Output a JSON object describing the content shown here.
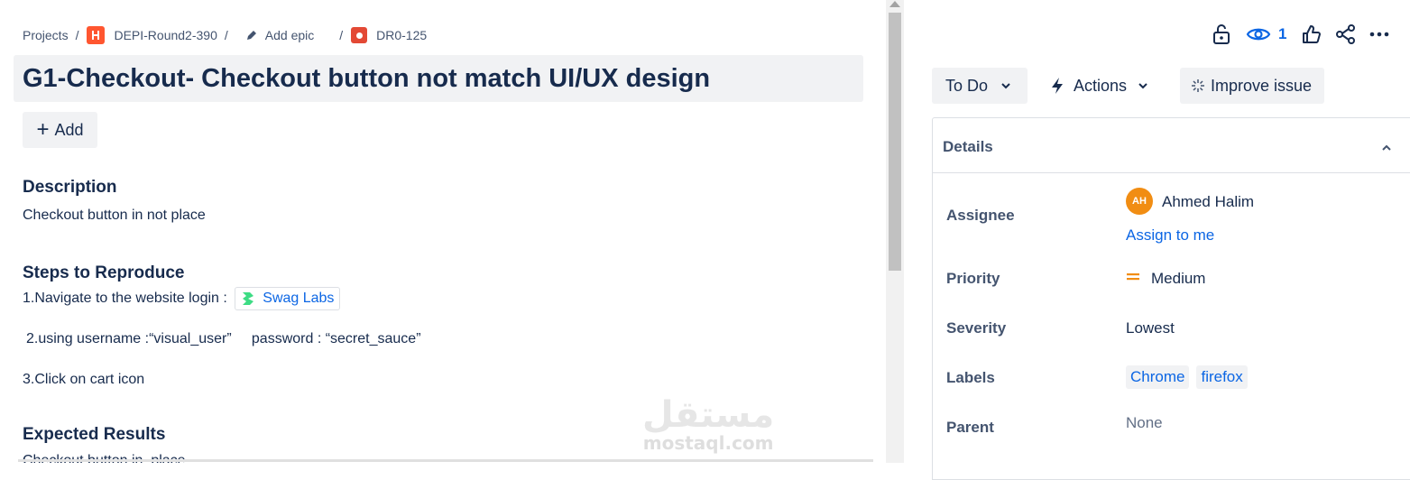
{
  "breadcrumb": {
    "projects": "Projects",
    "separator": "/",
    "project_name": "DEPI-Round2-390",
    "add_epic": "Add epic",
    "issue_key": "DR0-125"
  },
  "issue": {
    "title": "G1-Checkout- Checkout button not match UI/UX design",
    "add_label": "Add"
  },
  "description": {
    "heading": "Description",
    "text": "Checkout button in not place"
  },
  "steps": {
    "heading": "Steps to Reproduce",
    "step1_prefix": "1.Navigate to the website login :",
    "step1_link": "Swag Labs",
    "step2": "2.using username :“visual_user”     password : “secret_sauce”",
    "step3": "3.Click on cart icon"
  },
  "expected": {
    "heading": "Expected Results",
    "text": "Checkout button in  place"
  },
  "watermark": {
    "arabic": "مستقل",
    "latin": "mostaql.com"
  },
  "toolbar": {
    "watchers_count": "1",
    "status_label": "To Do",
    "actions_label": "Actions",
    "improve_label": "Improve issue"
  },
  "details": {
    "heading": "Details",
    "assignee_label": "Assignee",
    "assignee_initials": "AH",
    "assignee_name": "Ahmed Halim",
    "assign_to_me": "Assign to me",
    "priority_label": "Priority",
    "priority_value": "Medium",
    "severity_label": "Severity",
    "severity_value": "Lowest",
    "labels_label": "Labels",
    "labels": [
      "Chrome",
      "firefox"
    ],
    "parent_label": "Parent",
    "parent_value": "None"
  },
  "colors": {
    "link": "#0c66e4",
    "text": "#172b4d",
    "muted": "#44546f",
    "button_bg": "#f1f2f4",
    "priority_medium": "#f18d13",
    "avatar": "#f18d13"
  }
}
